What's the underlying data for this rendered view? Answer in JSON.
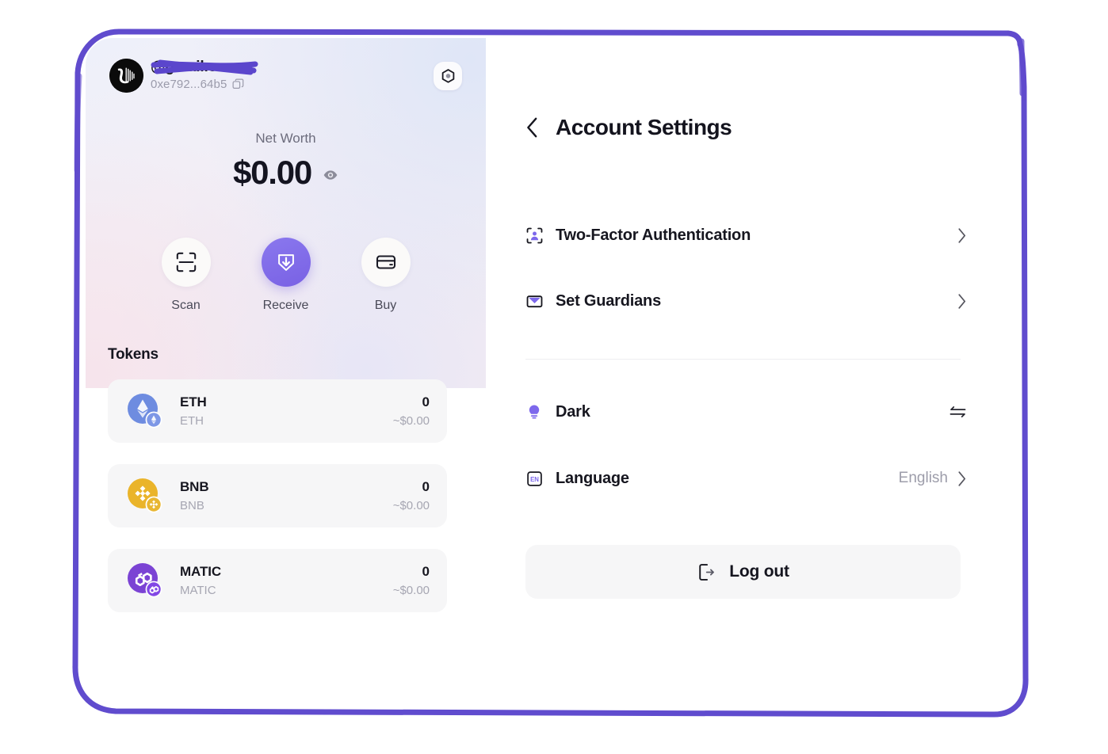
{
  "wallet": {
    "account": {
      "email": "@gmail.com",
      "email_redacted": true,
      "address": "0xe792...64b5",
      "copy_icon": "copy-icon",
      "avatar_icon": "avatar-identicon",
      "settings_nut_icon": "hex-nut-icon"
    },
    "net_worth": {
      "label": "Net Worth",
      "value": "$0.00",
      "visibility_icon": "eye-icon"
    },
    "actions": [
      {
        "label": "Scan",
        "icon": "scan-qr-icon",
        "primary": false
      },
      {
        "label": "Receive",
        "icon": "shield-down-arrow-icon",
        "primary": true
      },
      {
        "label": "Buy",
        "icon": "credit-card-icon",
        "primary": false
      }
    ],
    "tokens_heading": "Tokens",
    "tokens": [
      {
        "symbol": "ETH",
        "network": "ETH",
        "amount": "0",
        "fiat": "~$0.00",
        "color": "#6e8ce0",
        "badge_color": "#7d97e6",
        "logo": "ethereum-logo"
      },
      {
        "symbol": "BNB",
        "network": "BNB",
        "amount": "0",
        "fiat": "~$0.00",
        "color": "#eab42a",
        "badge_color": "#e8b632",
        "logo": "binance-logo"
      },
      {
        "symbol": "MATIC",
        "network": "MATIC",
        "amount": "0",
        "fiat": "~$0.00",
        "color": "#7b43d4",
        "badge_color": "#8247e5",
        "logo": "polygon-logo"
      }
    ]
  },
  "settings": {
    "back_icon": "chevron-left-icon",
    "title": "Account Settings",
    "items": [
      {
        "label": "Two-Factor Authentication",
        "icon": "person-scan-icon",
        "value": "",
        "trailing": "chevron-right-icon"
      },
      {
        "label": "Set Guardians",
        "icon": "mail-icon",
        "value": "",
        "trailing": "chevron-right-icon"
      },
      {
        "label": "Dark",
        "icon": "lightbulb-icon",
        "value": "",
        "trailing": "swap-arrows-icon"
      },
      {
        "label": "Language",
        "icon": "en-badge-icon",
        "value": "English",
        "trailing": "chevron-right-icon"
      }
    ],
    "logout": {
      "label": "Log out",
      "icon": "logout-icon"
    }
  },
  "theme": {
    "accent_purple": "#7961e4",
    "frame_purple": "#5b46cc",
    "text_dark": "#16161f",
    "text_muted": "#9d9daa",
    "surface_gray": "#f6f6f7"
  }
}
